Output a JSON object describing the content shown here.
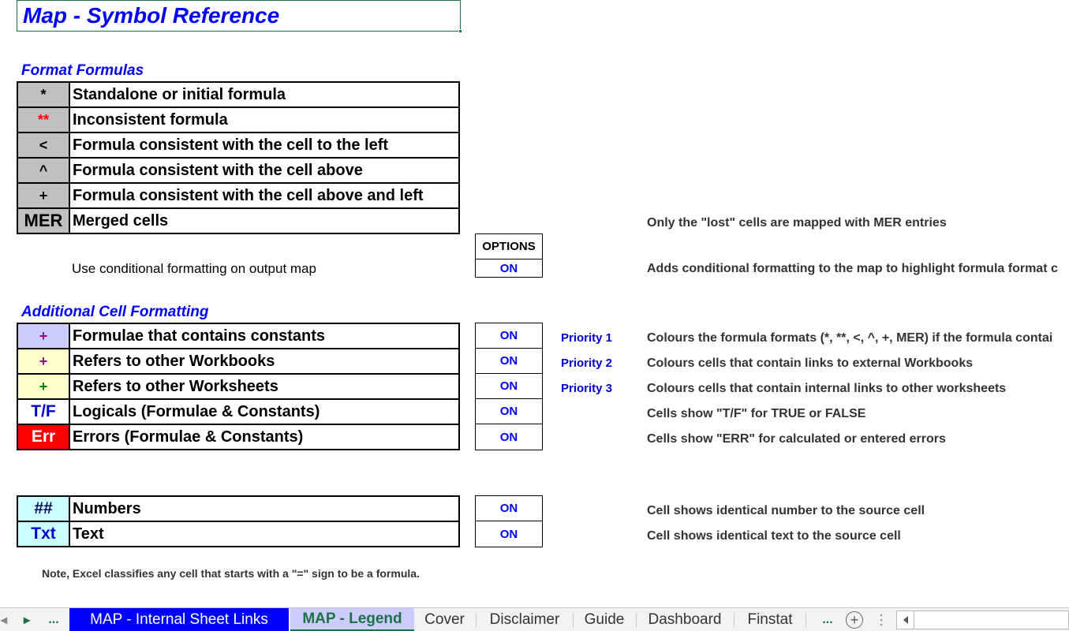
{
  "title": "Map - Symbol Reference",
  "format_formulas": {
    "heading": "Format Formulas",
    "rows": [
      {
        "symbol": "*",
        "label": "Standalone or initial formula",
        "bg": "#c0c0c0",
        "fg": "#000000"
      },
      {
        "symbol": "**",
        "label": "Inconsistent formula",
        "bg": "#c0c0c0",
        "fg": "#ff0000"
      },
      {
        "symbol": "<",
        "label": "Formula consistent with the cell to the left",
        "bg": "#c0c0c0",
        "fg": "#000000"
      },
      {
        "symbol": "^",
        "label": "Formula consistent with the cell above",
        "bg": "#c0c0c0",
        "fg": "#000000"
      },
      {
        "symbol": "+",
        "label": "Formula consistent with the cell above and left",
        "bg": "#c0c0c0",
        "fg": "#000000"
      },
      {
        "symbol": "MER",
        "label": "Merged cells",
        "bg": "#c0c0c0",
        "fg": "#000000"
      }
    ],
    "merged_note": "Only the \"lost\" cells are mapped with MER entries"
  },
  "options": {
    "header": "OPTIONS",
    "cond_label": "Use conditional formatting on output map",
    "cond_value": "ON",
    "cond_note": "Adds conditional formatting to the map to highlight formula format c"
  },
  "additional": {
    "heading": "Additional Cell Formatting",
    "rows": [
      {
        "symbol": "+",
        "label": "Formulae that contains constants",
        "bg": "#ccccff",
        "fg": "#990099",
        "value": "ON",
        "priority": "Priority 1",
        "note": "Colours the formula formats (*, **, <, ^, +, MER) if the formula contai"
      },
      {
        "symbol": "+",
        "label": "Refers to other Workbooks",
        "bg": "#ffffcc",
        "fg": "#990099",
        "value": "ON",
        "priority": "Priority 2",
        "note": "Colours cells that contain links to external Workbooks"
      },
      {
        "symbol": "+",
        "label": "Refers to other Worksheets",
        "bg": "#ffffcc",
        "fg": "#008000",
        "value": "ON",
        "priority": "Priority 3",
        "note": "Colours cells that contain internal links to other worksheets"
      },
      {
        "symbol": "T/F",
        "label": "Logicals (Formulae & Constants)",
        "bg": "#ffffff",
        "fg": "#0000cc",
        "value": "ON",
        "priority": "",
        "note": "Cells show \"T/F\" for TRUE or FALSE"
      },
      {
        "symbol": "Err",
        "label": "Errors (Formulae & Constants)",
        "bg": "#ff0000",
        "fg": "#ffffff",
        "value": "ON",
        "priority": "",
        "note": "Cells show \"ERR\" for calculated or entered errors"
      }
    ]
  },
  "values": {
    "rows": [
      {
        "symbol": "##",
        "label": "Numbers",
        "bg": "#ccffff",
        "fg": "#000066",
        "value": "ON",
        "note": "Cell shows identical number to the source cell"
      },
      {
        "symbol": "Txt",
        "label": "Text",
        "bg": "#ccffff",
        "fg": "#0000cc",
        "value": "ON",
        "note": "Cell shows identical text to the source cell"
      }
    ]
  },
  "footnote": "Note, Excel classifies any cell that starts with a \"=\" sign to be a formula.",
  "tabs": {
    "nav_prev": "◂",
    "nav_next": "▸",
    "ellipsis_left": "...",
    "ellipsis_right": "...",
    "add": "+",
    "items": [
      {
        "label": "MAP  - Internal Sheet Links",
        "style": "blue"
      },
      {
        "label": "MAP - Legend",
        "style": "active"
      },
      {
        "label": "Cover",
        "style": "normal"
      },
      {
        "label": "Disclaimer",
        "style": "normal"
      },
      {
        "label": "Guide",
        "style": "normal"
      },
      {
        "label": "Dashboard",
        "style": "normal"
      },
      {
        "label": "Finstat",
        "style": "normal"
      }
    ]
  }
}
